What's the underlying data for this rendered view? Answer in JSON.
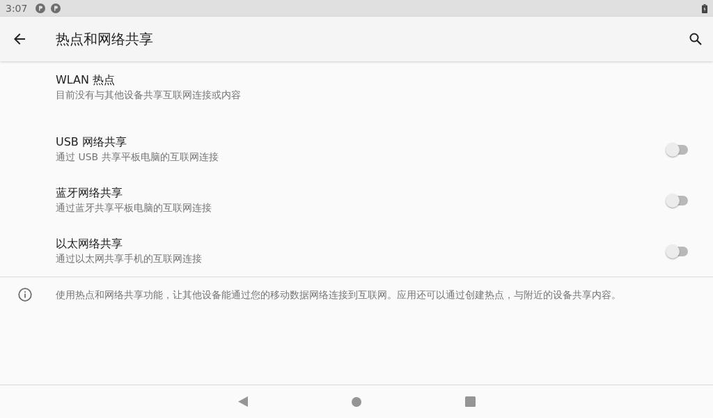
{
  "status_bar": {
    "time": "3:07"
  },
  "app_bar": {
    "title": "热点和网络共享"
  },
  "settings": [
    {
      "kind": "link",
      "title": "WLAN 热点",
      "summary": "目前没有与其他设备共享互联网连接或内容"
    },
    {
      "kind": "switch",
      "title": "USB 网络共享",
      "summary": "通过 USB 共享平板电脑的互联网连接",
      "on": false
    },
    {
      "kind": "switch",
      "title": "蓝牙网络共享",
      "summary": "通过蓝牙共享平板电脑的互联网连接",
      "on": false
    },
    {
      "kind": "switch",
      "title": "以太网络共享",
      "summary": "通过以太网共享手机的互联网连接",
      "on": false
    }
  ],
  "footer": {
    "text": "使用热点和网络共享功能，让其他设备能通过您的移动数据网络连接到互联网。应用还可以通过创建热点，与附近的设备共享内容。"
  }
}
